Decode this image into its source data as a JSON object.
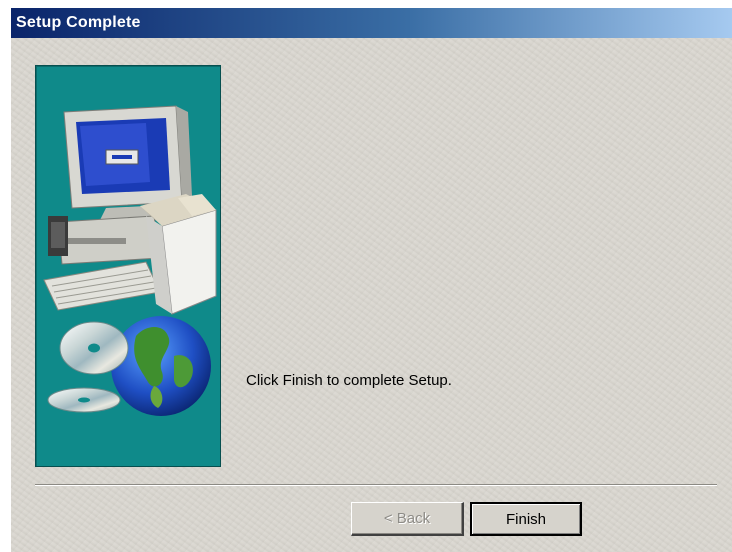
{
  "window": {
    "title": "Setup Complete"
  },
  "main": {
    "message": "Click Finish to complete Setup."
  },
  "buttons": {
    "back_label": "< Back",
    "finish_label": "Finish"
  },
  "side_panel": {
    "image_name": "computer-and-globe-illustration",
    "background_color": "#0f8a8a"
  },
  "colors": {
    "title_bar_start": "#0a246a",
    "title_bar_end": "#a6caf0",
    "dialog_background": "#d9d6cf"
  }
}
